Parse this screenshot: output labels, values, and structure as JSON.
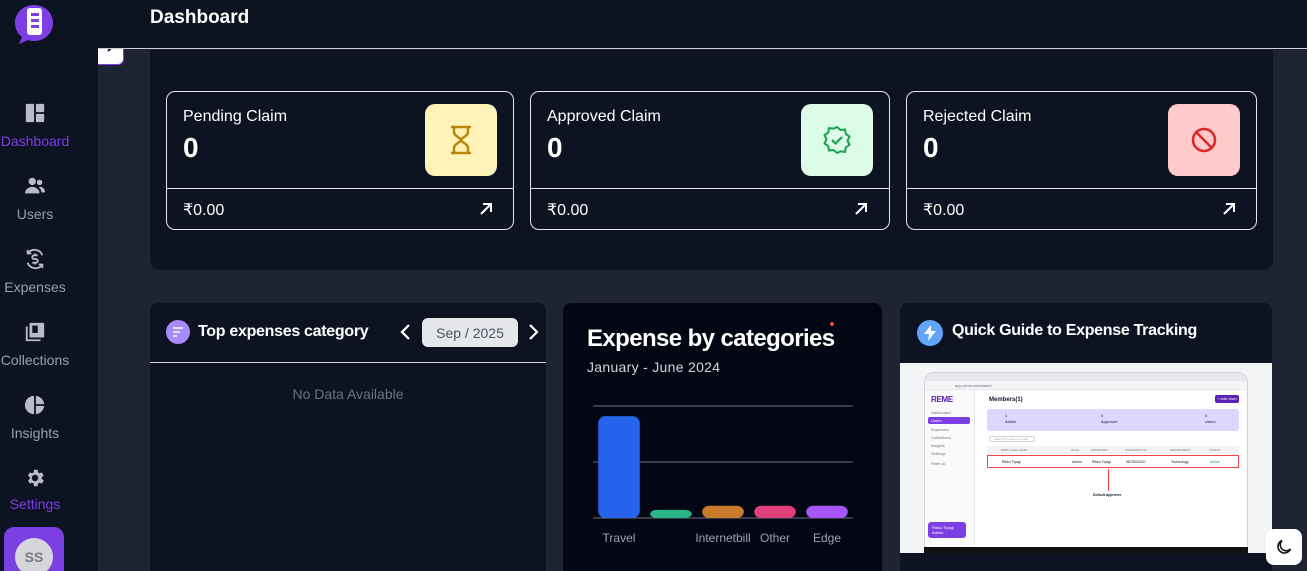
{
  "header": {
    "title": "Dashboard"
  },
  "sidebar": {
    "items": [
      {
        "label": "Dashboard",
        "icon": "dashboard-icon",
        "active": true
      },
      {
        "label": "Users",
        "icon": "users-icon"
      },
      {
        "label": "Expenses",
        "icon": "expenses-icon"
      },
      {
        "label": "Collections",
        "icon": "collections-icon"
      },
      {
        "label": "Insights",
        "icon": "insights-icon"
      },
      {
        "label": "Settings",
        "icon": "gear-icon"
      }
    ],
    "avatar": "SS",
    "accent": "#7b3fe4"
  },
  "stats": [
    {
      "title": "Pending Claim",
      "count": "0",
      "amount": "₹0.00",
      "icon": "hourglass-icon",
      "icon_bg": "#fef3b8",
      "icon_color": "#b8860b"
    },
    {
      "title": "Approved Claim",
      "count": "0",
      "amount": "₹0.00",
      "icon": "verified-badge-icon",
      "icon_bg": "#dcfce7",
      "icon_color": "#16a34a"
    },
    {
      "title": "Rejected Claim",
      "count": "0",
      "amount": "₹0.00",
      "icon": "block-icon",
      "icon_bg": "#fecaca",
      "icon_color": "#dc2626"
    }
  ],
  "top_expenses": {
    "title": "Top expenses category",
    "month": "Sep / 2025",
    "empty": "No Data Available"
  },
  "expense_by_categories": {
    "title": "Expense by categories",
    "subtitle": "January - June 2024"
  },
  "chart_data": {
    "type": "bar",
    "title": "Expense by categories",
    "subtitle": "January - June 2024",
    "categories": [
      "Travel",
      "",
      "Internetbill",
      "Other",
      "Edge"
    ],
    "values": [
      100,
      8,
      12,
      12,
      12
    ],
    "ylim": [
      0,
      110
    ],
    "colors": [
      "#2563eb",
      "#2bb58b",
      "#c97a2b",
      "#e0407a",
      "#a855f7"
    ],
    "grid": true
  },
  "quick_guide": {
    "title": "Quick Guide to Expense Tracking",
    "screenshot": {
      "logo": "REME",
      "address": "app.reme.com/users",
      "page_title": "Members(1)",
      "add_button": "+ Add User",
      "nav": [
        "Dashboard",
        "Users",
        "Expenses",
        "Collections",
        "Insights",
        "Settings",
        "Refer AI"
      ],
      "stats": [
        {
          "value": "1",
          "label": "Admin"
        },
        {
          "value": "0",
          "label": "Approver"
        },
        {
          "value": "0",
          "label": "Users"
        }
      ],
      "search": "Search by name or email",
      "columns": [
        "EMPLOYEE NAME",
        "ROLE",
        "APPROVER",
        "WHATSAPP NO",
        "DEPARTMENT",
        "STATUS"
      ],
      "row": {
        "name": "Rikku Tiyagi",
        "email": "rikku@example.com",
        "role": "Admin",
        "approver": "Rikku Tiyagi",
        "phone": "9876543210",
        "department": "Technology",
        "status": "Active"
      },
      "callout": "Default Approver",
      "user_card": {
        "name": "Rikku Tiyagi",
        "role": "Admin"
      }
    }
  }
}
